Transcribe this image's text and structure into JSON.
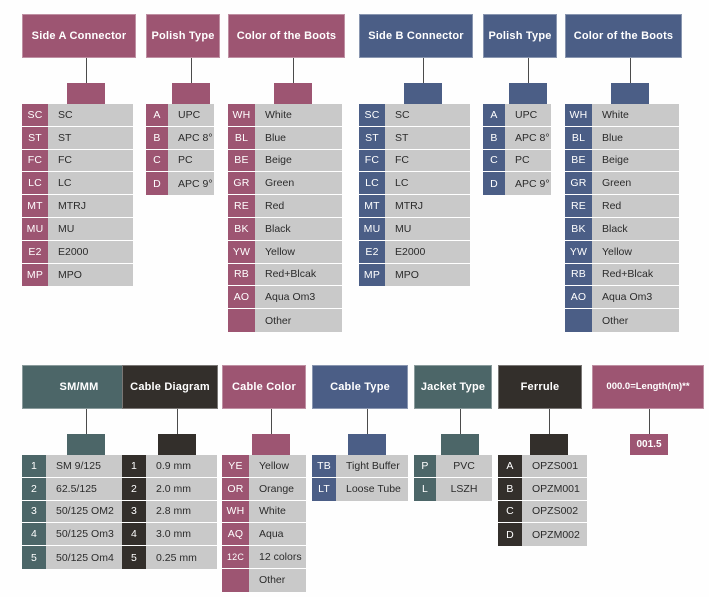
{
  "palette": {
    "mauve": "#9d5572",
    "navy": "#4b5e86",
    "teal": "#4c6668",
    "charcoal": "#332f2b",
    "label_gray": "#c9c9c9",
    "line": "#4b4b4b",
    "background": "#fefefe",
    "header_text": "#ffffff"
  },
  "groups": [
    {
      "id": "side-a-connector",
      "title": "Side A Connector",
      "color_key": "mauve",
      "stub_value": "",
      "title_tight": false,
      "label_align": "left",
      "code_width": 26,
      "rows": [
        {
          "code": "SC",
          "label": "SC"
        },
        {
          "code": "ST",
          "label": "ST"
        },
        {
          "code": "FC",
          "label": "FC"
        },
        {
          "code": "LC",
          "label": "LC"
        },
        {
          "code": "MT",
          "label": "MTRJ"
        },
        {
          "code": "MU",
          "label": "MU"
        },
        {
          "code": "E2",
          "label": "E2000"
        },
        {
          "code": "MP",
          "label": "MPO"
        }
      ]
    },
    {
      "id": "polish-type-a",
      "title": "Polish Type",
      "color_key": "mauve",
      "stub_value": "",
      "title_tight": false,
      "label_align": "left",
      "code_width": 22,
      "rows": [
        {
          "code": "A",
          "label": "UPC"
        },
        {
          "code": "B",
          "label": "APC 8°"
        },
        {
          "code": "C",
          "label": "PC"
        },
        {
          "code": "D",
          "label": "APC 9°"
        }
      ]
    },
    {
      "id": "color-of-the-boots-a",
      "title": "Color of the Boots",
      "color_key": "mauve",
      "stub_value": "",
      "title_tight": false,
      "label_align": "left",
      "code_width": 27,
      "rows": [
        {
          "code": "WH",
          "label": "White"
        },
        {
          "code": "BL",
          "label": "Blue"
        },
        {
          "code": "BE",
          "label": "Beige"
        },
        {
          "code": "GR",
          "label": "Green"
        },
        {
          "code": "RE",
          "label": "Red"
        },
        {
          "code": "BK",
          "label": "Black"
        },
        {
          "code": "YW",
          "label": "Yellow"
        },
        {
          "code": "RB",
          "label": "Red+Blcak"
        },
        {
          "code": "AO",
          "label": "Aqua Om3"
        },
        {
          "code": "",
          "label": "Other"
        }
      ]
    },
    {
      "id": "side-b-connector",
      "title": "Side B Connector",
      "color_key": "navy",
      "stub_value": "",
      "title_tight": false,
      "label_align": "left",
      "code_width": 26,
      "rows": [
        {
          "code": "SC",
          "label": "SC"
        },
        {
          "code": "ST",
          "label": "ST"
        },
        {
          "code": "FC",
          "label": "FC"
        },
        {
          "code": "LC",
          "label": "LC"
        },
        {
          "code": "MT",
          "label": "MTRJ"
        },
        {
          "code": "MU",
          "label": "MU"
        },
        {
          "code": "E2",
          "label": "E2000"
        },
        {
          "code": "MP",
          "label": "MPO"
        }
      ]
    },
    {
      "id": "polish-type-b",
      "title": "Polish Type",
      "color_key": "navy",
      "stub_value": "",
      "title_tight": false,
      "label_align": "left",
      "code_width": 22,
      "rows": [
        {
          "code": "A",
          "label": "UPC"
        },
        {
          "code": "B",
          "label": "APC 8°"
        },
        {
          "code": "C",
          "label": "PC"
        },
        {
          "code": "D",
          "label": "APC 9°"
        }
      ]
    },
    {
      "id": "color-of-the-boots-b",
      "title": "Color of the Boots",
      "color_key": "navy",
      "stub_value": "",
      "title_tight": false,
      "label_align": "left",
      "code_width": 27,
      "rows": [
        {
          "code": "WH",
          "label": "White"
        },
        {
          "code": "BL",
          "label": "Blue"
        },
        {
          "code": "BE",
          "label": "Beige"
        },
        {
          "code": "GR",
          "label": "Green"
        },
        {
          "code": "RE",
          "label": "Red"
        },
        {
          "code": "BK",
          "label": "Black"
        },
        {
          "code": "YW",
          "label": "Yellow"
        },
        {
          "code": "RB",
          "label": "Red+Blcak"
        },
        {
          "code": "AO",
          "label": "Aqua Om3"
        },
        {
          "code": "",
          "label": "Other"
        }
      ]
    },
    {
      "id": "sm-mm",
      "title": "SM/MM",
      "color_key": "teal",
      "stub_value": "",
      "title_tight": false,
      "label_align": "left",
      "code_width": 24,
      "rows": [
        {
          "code": "1",
          "label": "SM 9/125"
        },
        {
          "code": "2",
          "label": "62.5/125"
        },
        {
          "code": "3",
          "label": "50/125 OM2"
        },
        {
          "code": "4",
          "label": "50/125 Om3"
        },
        {
          "code": "5",
          "label": "50/125 Om4"
        }
      ]
    },
    {
      "id": "cable-diagram",
      "title": "Cable Diagram",
      "color_key": "charcoal",
      "stub_value": "",
      "title_tight": false,
      "label_align": "left",
      "code_width": 24,
      "rows": [
        {
          "code": "1",
          "label": "0.9 mm"
        },
        {
          "code": "2",
          "label": "2.0 mm"
        },
        {
          "code": "3",
          "label": "2.8 mm"
        },
        {
          "code": "4",
          "label": "3.0 mm"
        },
        {
          "code": "5",
          "label": "0.25 mm"
        }
      ]
    },
    {
      "id": "cable-color",
      "title": "Cable Color",
      "color_key": "mauve",
      "stub_value": "",
      "title_tight": false,
      "label_align": "left",
      "code_width": 27,
      "rows": [
        {
          "code": "YE",
          "label": "Yellow"
        },
        {
          "code": "OR",
          "label": "Orange"
        },
        {
          "code": "WH",
          "label": "White"
        },
        {
          "code": "AQ",
          "label": "Aqua"
        },
        {
          "code": "12C",
          "label": "12 colors"
        },
        {
          "code": "",
          "label": "Other"
        }
      ]
    },
    {
      "id": "cable-type",
      "title": "Cable Type",
      "color_key": "navy",
      "stub_value": "",
      "title_tight": false,
      "label_align": "left",
      "code_width": 24,
      "rows": [
        {
          "code": "TB",
          "label": "Tight Buffer"
        },
        {
          "code": "LT",
          "label": "Loose Tube"
        }
      ]
    },
    {
      "id": "jacket-type",
      "title": "Jacket Type",
      "color_key": "teal",
      "stub_value": "",
      "title_tight": false,
      "label_align": "center",
      "code_width": 22,
      "rows": [
        {
          "code": "P",
          "label": "PVC"
        },
        {
          "code": "L",
          "label": "LSZH"
        }
      ]
    },
    {
      "id": "ferrule",
      "title": "Ferrule",
      "color_key": "charcoal",
      "stub_value": "",
      "title_tight": false,
      "label_align": "left",
      "code_width": 24,
      "rows": [
        {
          "code": "A",
          "label": "OPZS001"
        },
        {
          "code": "B",
          "label": "OPZM001"
        },
        {
          "code": "C",
          "label": "OPZS002"
        },
        {
          "code": "D",
          "label": "OPZM002"
        }
      ]
    },
    {
      "id": "length",
      "title": "000.0=Length(m)**",
      "color_key": "mauve",
      "stub_value": "001.5",
      "title_tight": true,
      "label_align": "left",
      "code_width": 24,
      "rows": []
    }
  ]
}
